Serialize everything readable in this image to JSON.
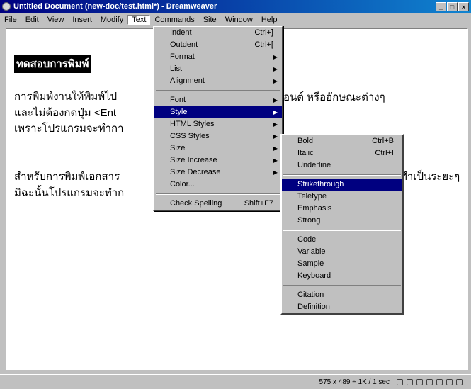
{
  "window": {
    "title": "Untitled Document (new-doc/test.html*) - Dreamweaver",
    "buttons": [
      "_",
      "□",
      "×"
    ]
  },
  "menubar": [
    "File",
    "Edit",
    "View",
    "Insert",
    "Modify",
    "Text",
    "Commands",
    "Site",
    "Window",
    "Help"
  ],
  "document": {
    "heading": "ทดสอบการพิมพ์",
    "lines": [
      "การพิมพ์งานให้พิมพ์ไป",
      "และไม่ต้องกดปุ่ม <Ent",
      "เพราะโปรแกรมจะทำกา",
      "สำหรับการพิมพ์เอกสาร",
      "มิฉะนั้นโปรแกรมจะทำก"
    ],
    "line_tails": [
      "อนต์ หรืออักษณะต่างๆ",
      "ทำเป็นระยะๆ"
    ]
  },
  "text_menu": [
    {
      "label": "Indent",
      "shortcut": "Ctrl+]"
    },
    {
      "label": "Outdent",
      "shortcut": "Ctrl+["
    },
    {
      "label": "Format",
      "submenu": true
    },
    {
      "label": "List",
      "submenu": true
    },
    {
      "label": "Alignment",
      "submenu": true
    },
    {
      "sep": true
    },
    {
      "label": "Font",
      "submenu": true
    },
    {
      "label": "Style",
      "submenu": true,
      "selected": true
    },
    {
      "label": "HTML Styles",
      "submenu": true
    },
    {
      "label": "CSS Styles",
      "submenu": true
    },
    {
      "label": "Size",
      "submenu": true
    },
    {
      "label": "Size Increase",
      "submenu": true
    },
    {
      "label": "Size Decrease",
      "submenu": true
    },
    {
      "label": "Color..."
    },
    {
      "sep": true
    },
    {
      "label": "Check Spelling",
      "shortcut": "Shift+F7"
    }
  ],
  "style_menu": [
    {
      "label": "Bold",
      "shortcut": "Ctrl+B"
    },
    {
      "label": "Italic",
      "shortcut": "Ctrl+I"
    },
    {
      "label": "Underline"
    },
    {
      "sep": true
    },
    {
      "label": "Strikethrough",
      "selected": true
    },
    {
      "label": "Teletype"
    },
    {
      "label": "Emphasis"
    },
    {
      "label": "Strong"
    },
    {
      "sep": true
    },
    {
      "label": "Code"
    },
    {
      "label": "Variable"
    },
    {
      "label": "Sample"
    },
    {
      "label": "Keyboard"
    },
    {
      "sep": true
    },
    {
      "label": "Citation"
    },
    {
      "label": "Definition"
    }
  ],
  "status": {
    "text": "575 x 489 ÷ 1K / 1 sec"
  }
}
